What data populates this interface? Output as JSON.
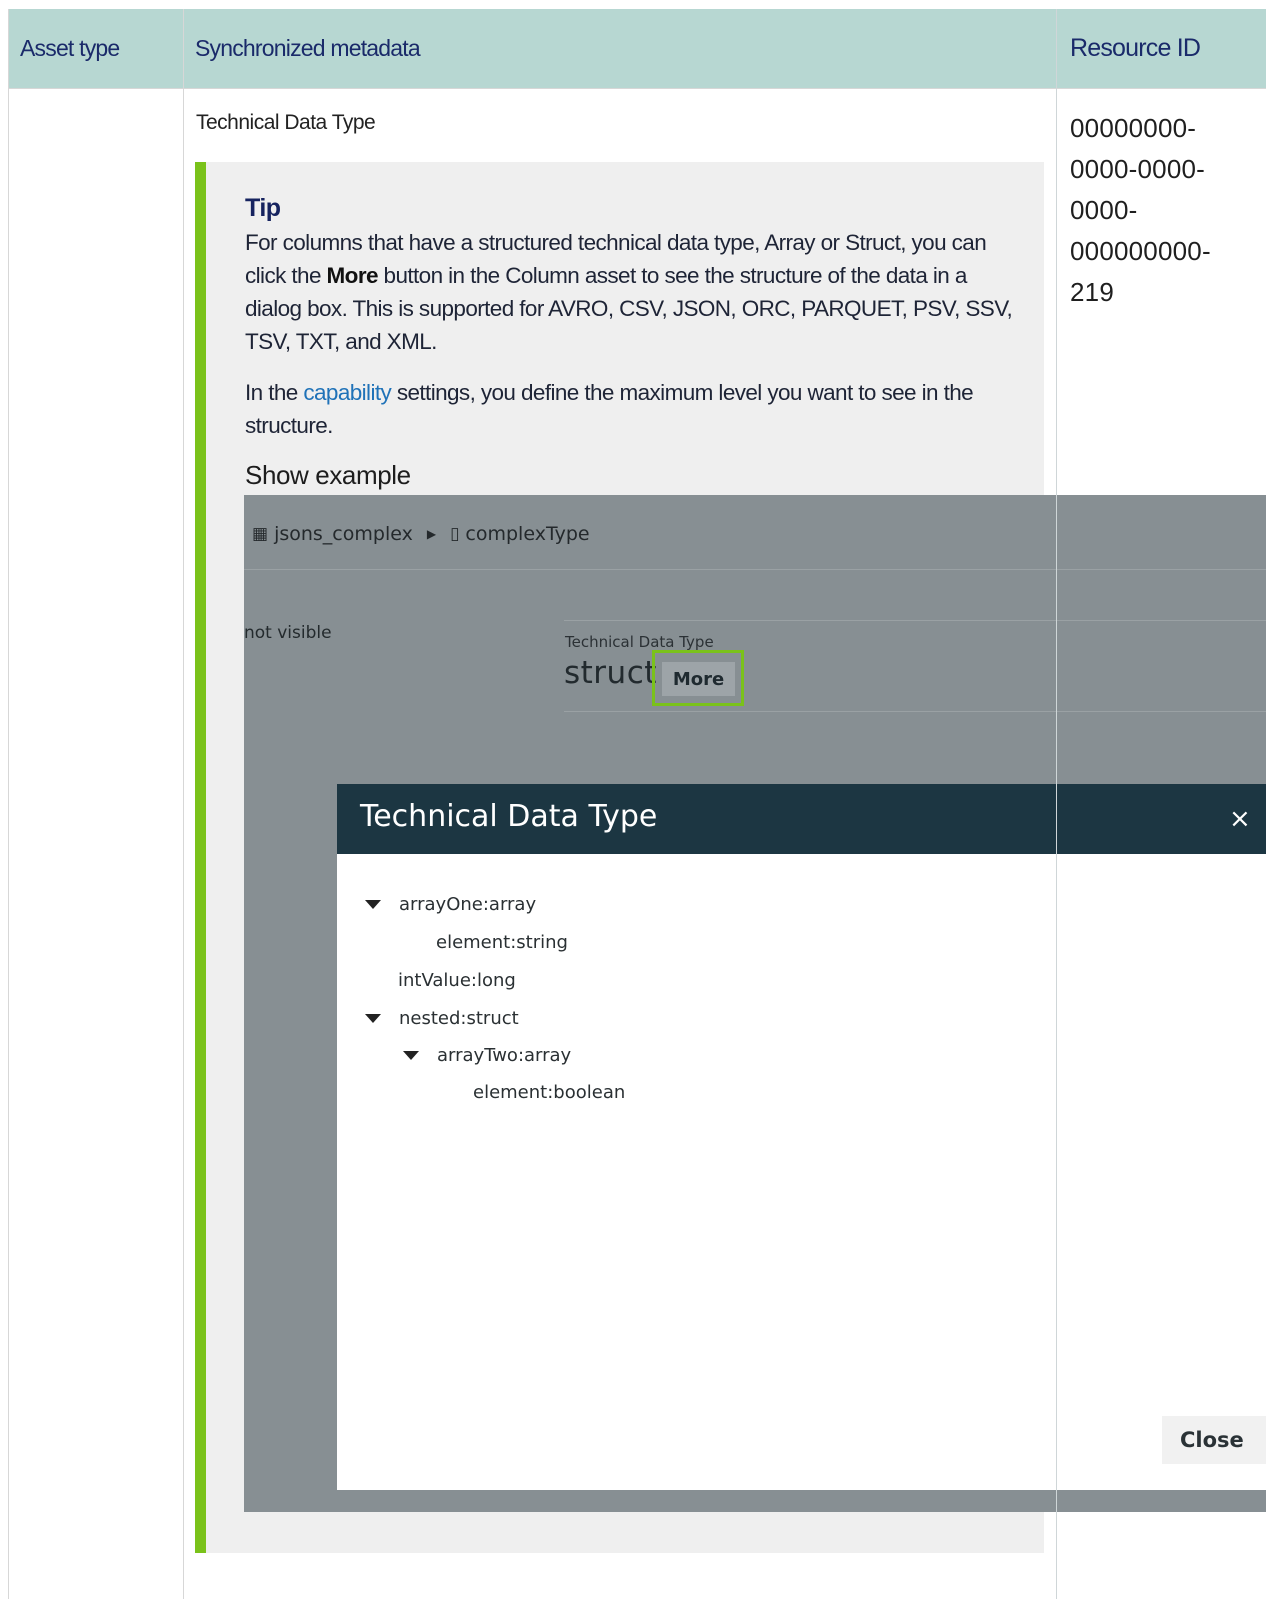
{
  "table": {
    "headers": {
      "asset_type": "Asset type",
      "synchronized_metadata": "Synchronized metadata",
      "resource_id": "Resource ID"
    },
    "row": {
      "metadata": "Technical Data Type",
      "resource_id_lines": [
        "00000000-",
        "0000-0000-",
        "0000-",
        "000000000-",
        "219"
      ]
    }
  },
  "tip": {
    "title": "Tip",
    "p1_before": "For columns that have a structured technical data type, Array or Struct, you can click the ",
    "p1_bold": "More",
    "p1_after": " button in the Column asset to see the structure of the data in a dialog box. This is supported for AVRO, CSV, JSON, ORC, PARQUET, PSV, SSV, TSV, TXT, and XML.",
    "p2_before": "In the ",
    "p2_link": "capability",
    "p2_after": " settings, you define the maximum level you want to see in the structure.",
    "show_example": "Show example",
    "accent_color": "#7ac21a"
  },
  "example": {
    "breadcrumb": {
      "table_name": "jsons_complex",
      "column_name": "complexType"
    },
    "not_visible": "not visible",
    "attribute_label": "Technical Data Type",
    "attribute_value": "struct",
    "more_label": "More",
    "dialog": {
      "title": "Technical Data Type",
      "close_glyph": "×",
      "tree": [
        {
          "text": "arrayOne:array",
          "expandable": true
        },
        {
          "text": "element:string",
          "expandable": false
        },
        {
          "text": "intValue:long",
          "expandable": false
        },
        {
          "text": "nested:struct",
          "expandable": true
        },
        {
          "text": "arrayTwo:array",
          "expandable": true
        },
        {
          "text": "element:boolean",
          "expandable": false
        }
      ],
      "close_label": "Close"
    }
  }
}
